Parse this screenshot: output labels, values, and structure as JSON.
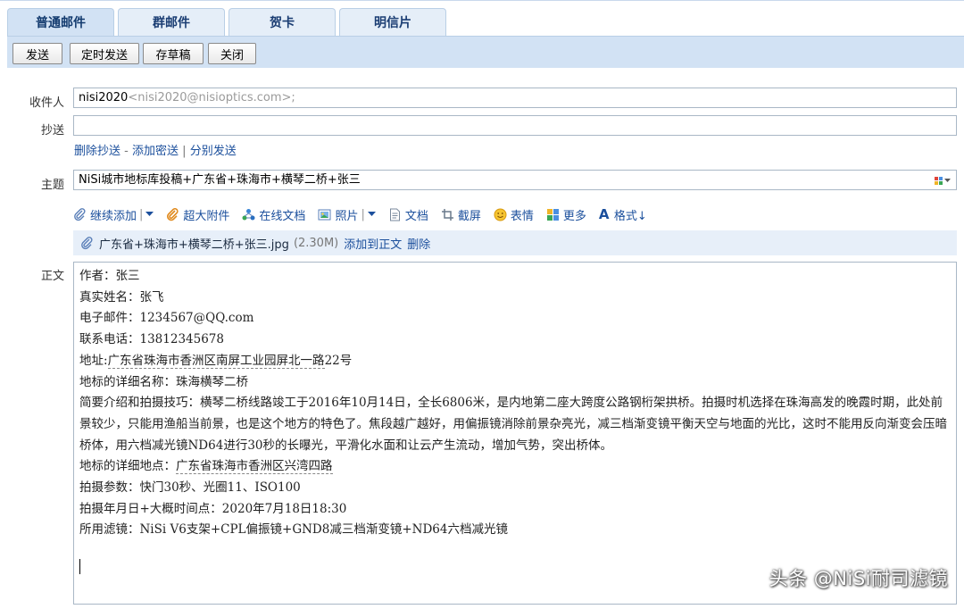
{
  "tabs": [
    "普通邮件",
    "群邮件",
    "贺卡",
    "明信片"
  ],
  "toolbar": {
    "send": "发送",
    "scheduled_send": "定时发送",
    "save_draft": "存草稿",
    "close": "关闭"
  },
  "recipient": {
    "label": "收件人",
    "name": "nisi2020",
    "address": "<nisi2020@nisioptics.com>;"
  },
  "cc": {
    "label": "抄送",
    "value": ""
  },
  "cc_links": {
    "remove_cc": "删除抄送",
    "dash": "-",
    "add_bcc": "添加密送",
    "bar": "|",
    "separate_send": "分别发送"
  },
  "subject": {
    "label": "主题",
    "value": "NiSi城市地标库投稿+广东省+珠海市+横琴二桥+张三"
  },
  "attach_toolbar": {
    "continue_add": "继续添加",
    "large_attach": "超大附件",
    "online_doc": "在线文档",
    "photo": "照片",
    "document": "文档",
    "screenshot": "截屏",
    "emoji": "表情",
    "more": "更多",
    "format": "格式↓"
  },
  "attachment": {
    "filename": "广东省+珠海市+横琴二桥+张三.jpg",
    "size": "(2.30M)",
    "add_to_body": "添加到正文",
    "delete": "删除"
  },
  "body": {
    "label": "正文",
    "line1": "作者：张三",
    "line2": "真实姓名：张飞",
    "line3": "电子邮件：1234567@QQ.com",
    "line4": "联系电话：13812345678",
    "line5_prefix": "地址:",
    "line5_addr": "广东省珠海市香洲区南屏工业园屏北一路",
    "line5_suffix": "22号",
    "line6": "地标的详细名称：珠海横琴二桥",
    "line7": "简要介绍和拍摄技巧：横琴二桥线路竣工于2016年10月14日，全长6806米，是内地第二座大跨度公路钢桁架拱桥。拍摄时机选择在珠海高发的晚霞时期，此处前景较少，只能用渔船当前景，也是这个地方的特色了。焦段越广越好，用偏振镜消除前景杂亮光，减三档渐变镜平衡天空与地面的光比，这时不能用反向渐变会压暗桥体，用六档减光镜ND64进行30秒的长曝光，平滑化水面和让云产生流动，增加气势，突出桥体。",
    "line8_prefix": "地标的详细地点：",
    "line8_addr": "广东省珠海市香洲区兴湾四路",
    "line9": "拍摄参数：快门30秒、光圈11、ISO100",
    "line10": "拍摄年月日+大概时间点：2020年7月18日18:30",
    "line11": "所用滤镜：NiSi V6支架+CPL偏振镜+GND8减三档渐变镜+ND64六档减光镜"
  },
  "watermark": "头条 @NiSi耐司滤镜",
  "colors": {
    "tab_bg": "#e5eef8",
    "toolbar_bg": "#d2e2f4",
    "link": "#1b4f9c"
  }
}
